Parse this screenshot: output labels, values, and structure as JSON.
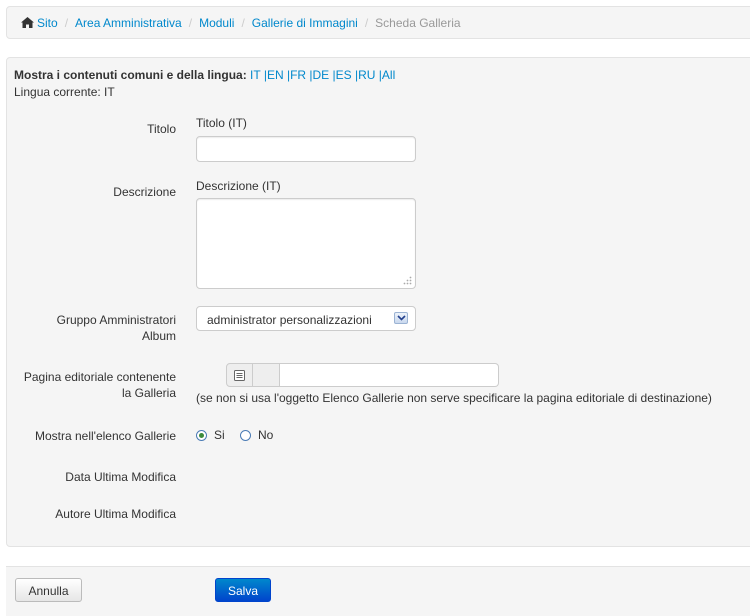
{
  "breadcrumb": {
    "items": [
      {
        "label": "Sito",
        "icon": "home-icon"
      },
      {
        "label": "Area Amministrativa"
      },
      {
        "label": "Moduli"
      },
      {
        "label": "Gallerie di Immagini"
      },
      {
        "label": "Scheda Galleria"
      }
    ],
    "separator": "/"
  },
  "language": {
    "prompt": "Mostra i contenuti comuni e della lingua:",
    "links": [
      "IT",
      "EN",
      "FR",
      "DE",
      "ES",
      "RU",
      "All"
    ],
    "current": "Lingua corrente: IT"
  },
  "form": {
    "title": {
      "label": "Titolo",
      "sublabel": "Titolo (IT)",
      "value": ""
    },
    "description": {
      "label": "Descrizione",
      "sublabel": "Descrizione (IT)",
      "value": ""
    },
    "admin_group": {
      "label_line1": "Gruppo Amministratori",
      "label_line2": "Album",
      "selected": "administrator personalizzazioni"
    },
    "editorial_page": {
      "label_line1": "Pagina editoriale contenente",
      "label_line2": "la Galleria",
      "value": "",
      "hint": "(se non si usa l'oggetto Elenco Gallerie non serve specificare la pagina editoriale di destinazione)"
    },
    "show_in_list": {
      "label": "Mostra nell'elenco Gallerie",
      "options": [
        "Si",
        "No"
      ],
      "selected": "Si"
    },
    "last_modified_date": {
      "label": "Data Ultima Modifica"
    },
    "last_modified_author": {
      "label": "Autore Ultima Modifica"
    }
  },
  "actions": {
    "cancel": "Annulla",
    "save": "Salva"
  },
  "colors": {
    "link": "#0088cc",
    "primary": "#0044cc",
    "panel_bg": "#f5f5f5"
  }
}
